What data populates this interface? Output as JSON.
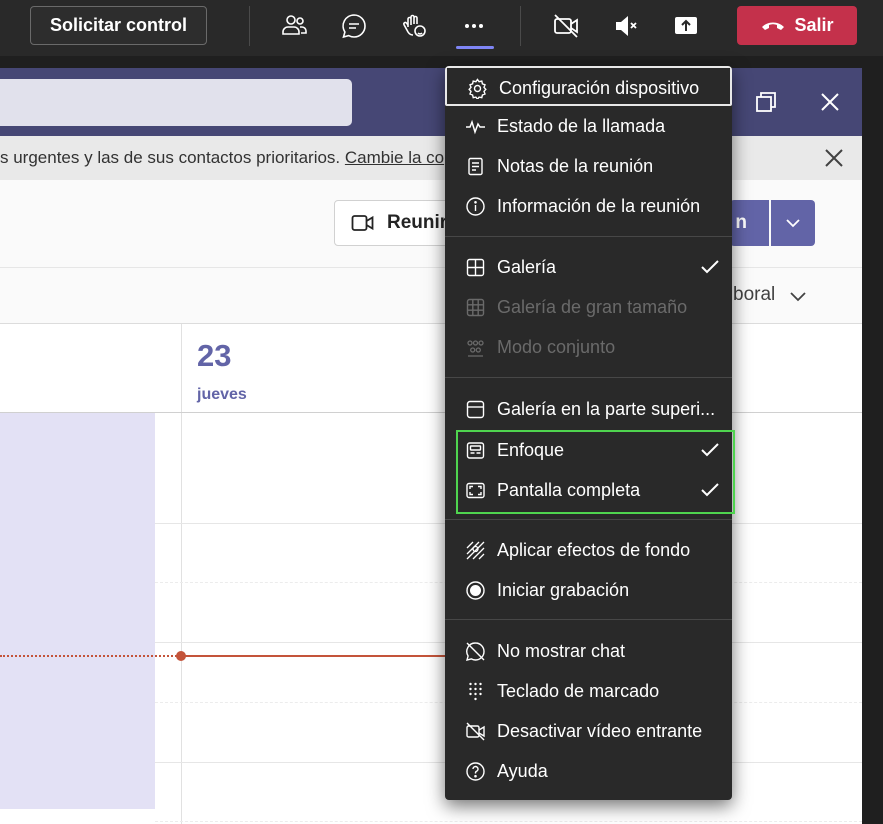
{
  "topbar": {
    "request_control_label": "Solicitar control",
    "leave_label": "Salir",
    "icons": [
      "people-icon",
      "chat-icon",
      "raise-hand-icon",
      "more-actions-icon",
      "camera-off-icon",
      "mic-muted-icon",
      "share-screen-icon",
      "hang-up-icon"
    ]
  },
  "banner": {
    "text": "s urgentes y las de sus contactos prioritarios. ",
    "link": "Cambie la co"
  },
  "toolbar": {
    "meet_now_label": "Reunir",
    "new_meeting_label": "n"
  },
  "view": {
    "label": "boral"
  },
  "calendar": {
    "day_number": "23",
    "day_name": "jueves"
  },
  "menu": {
    "items": [
      {
        "label": "Configuración dispositivo",
        "icon": "gear-icon",
        "checked": false,
        "disabled": false
      },
      {
        "label": "Estado de la llamada",
        "icon": "pulse-icon",
        "checked": false,
        "disabled": false
      },
      {
        "label": "Notas de la reunión",
        "icon": "notes-icon",
        "checked": false,
        "disabled": false
      },
      {
        "label": "Información de la reunión",
        "icon": "info-icon",
        "checked": false,
        "disabled": false
      },
      {
        "label": "Galería",
        "icon": "gallery-icon",
        "checked": true,
        "disabled": false
      },
      {
        "label": "Galería de gran tamaño",
        "icon": "large-gallery-icon",
        "checked": false,
        "disabled": true
      },
      {
        "label": "Modo conjunto",
        "icon": "together-mode-icon",
        "checked": false,
        "disabled": true
      },
      {
        "label": "Galería en la parte superi...",
        "icon": "gallery-top-icon",
        "checked": false,
        "disabled": false
      },
      {
        "label": "Enfoque",
        "icon": "focus-icon",
        "checked": true,
        "disabled": false
      },
      {
        "label": "Pantalla completa",
        "icon": "fullscreen-icon",
        "checked": true,
        "disabled": false
      },
      {
        "label": "Aplicar efectos de fondo",
        "icon": "background-effects-icon",
        "checked": false,
        "disabled": false
      },
      {
        "label": "Iniciar grabación",
        "icon": "record-icon",
        "checked": false,
        "disabled": false
      },
      {
        "label": "No mostrar chat",
        "icon": "chat-off-icon",
        "checked": false,
        "disabled": false
      },
      {
        "label": "Teclado de marcado",
        "icon": "dialpad-icon",
        "checked": false,
        "disabled": false
      },
      {
        "label": "Desactivar vídeo entrante",
        "icon": "video-off-icon",
        "checked": false,
        "disabled": false
      },
      {
        "label": "Ayuda",
        "icon": "help-icon",
        "checked": false,
        "disabled": false
      }
    ]
  },
  "colors": {
    "leave_button": "#c4314b",
    "accent": "#6264a7",
    "highlight_box": "#4fd44f",
    "menu_background": "#292929"
  }
}
